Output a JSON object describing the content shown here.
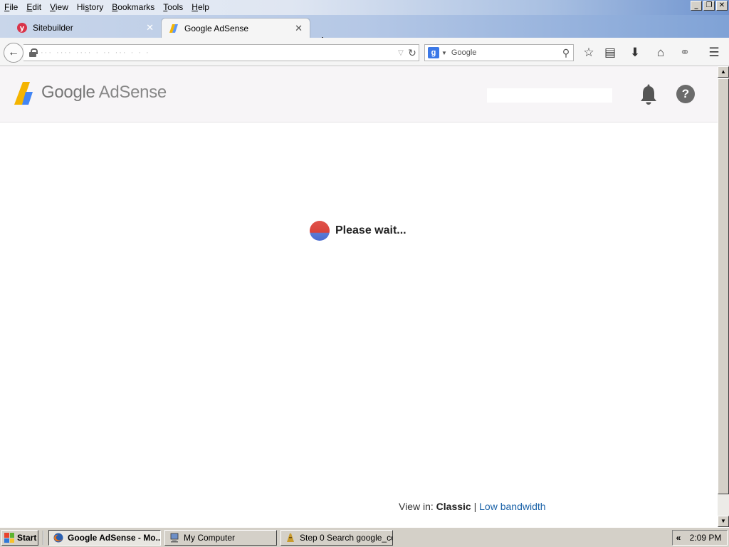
{
  "menubar": {
    "items": [
      {
        "accel": "F",
        "rest": "ile"
      },
      {
        "accel": "E",
        "rest": "dit"
      },
      {
        "accel": "V",
        "rest": "iew"
      },
      {
        "pre": "Hi",
        "accel": "s",
        "rest": "tory"
      },
      {
        "accel": "B",
        "rest": "ookmarks"
      },
      {
        "accel": "T",
        "rest": "ools"
      },
      {
        "accel": "H",
        "rest": "elp"
      }
    ]
  },
  "tabs": [
    {
      "title": "Sitebuilder",
      "icon": "sitebuilder-icon",
      "active": false
    },
    {
      "title": "Google AdSense",
      "icon": "adsense-icon",
      "active": true
    }
  ],
  "newtab": {
    "label": "+"
  },
  "search": {
    "placeholder": "Google"
  },
  "page": {
    "logo_google": "Google",
    "logo_adsense": "AdSense",
    "loading_text": "Please wait...",
    "view_in_label": "View in:",
    "view_classic": "Classic",
    "view_sep": "|",
    "view_low_bandwidth": "Low bandwidth"
  },
  "taskbar": {
    "start_label": "Start",
    "tasks": [
      {
        "label": "Google AdSense - Mo...",
        "icon": "firefox-icon",
        "active": true
      },
      {
        "label": "My Computer",
        "icon": "my-computer-icon",
        "active": false
      },
      {
        "label": "Step 0 Search google_co...",
        "icon": "notepad-icon",
        "active": false
      }
    ],
    "tray_arrow": "«",
    "clock": "2:09 PM"
  },
  "colors": {
    "link": "#1a62a8",
    "spinner_red": "#e0534a",
    "spinner_blue": "#4a6cd0",
    "header_bg": "#f7f5f7"
  }
}
